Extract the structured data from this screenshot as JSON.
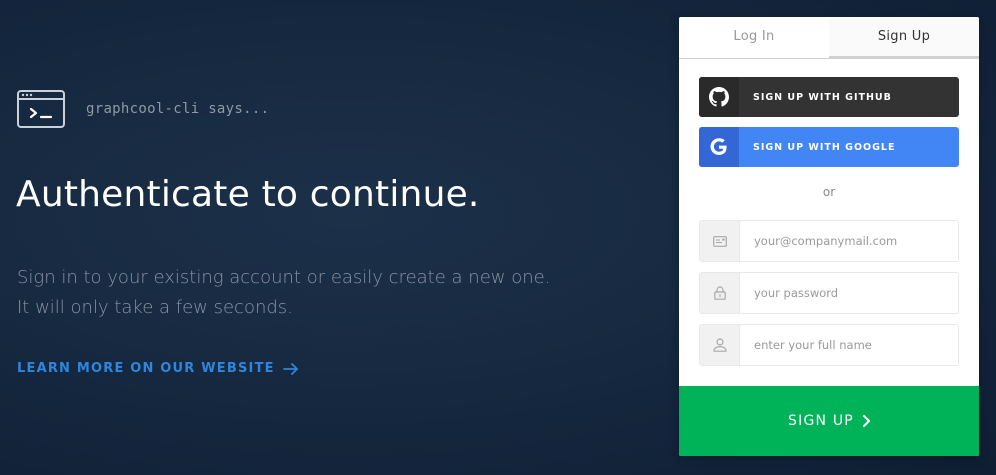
{
  "hero": {
    "cli_text": "graphcool-cli says...",
    "title": "Authenticate to continue.",
    "description_line1": "Sign in to your existing account or easily create a new one.",
    "description_line2": "It will only take a few seconds.",
    "learn_more": "LEARN MORE ON OUR WEBSITE"
  },
  "auth": {
    "tabs": [
      {
        "label": "Log In",
        "active": false
      },
      {
        "label": "Sign Up",
        "active": true
      }
    ],
    "github_button": "SIGN UP WITH GITHUB",
    "google_button": "SIGN UP WITH GOOGLE",
    "separator": "or",
    "fields": {
      "email_placeholder": "your@companymail.com",
      "password_placeholder": "your password",
      "name_placeholder": "enter your full name"
    },
    "submit_label": "SIGN UP"
  },
  "icons": {
    "terminal": "terminal-icon",
    "github": "github-icon",
    "google": "google-icon",
    "email": "envelope-icon",
    "password": "lock-icon",
    "name": "user-icon",
    "arrow": "arrow-right-icon",
    "chevron": "chevron-right-icon"
  },
  "colors": {
    "background": "#172a41",
    "link": "#2e86de",
    "github": "#333333",
    "google": "#4285f4",
    "submit": "#00b359"
  }
}
